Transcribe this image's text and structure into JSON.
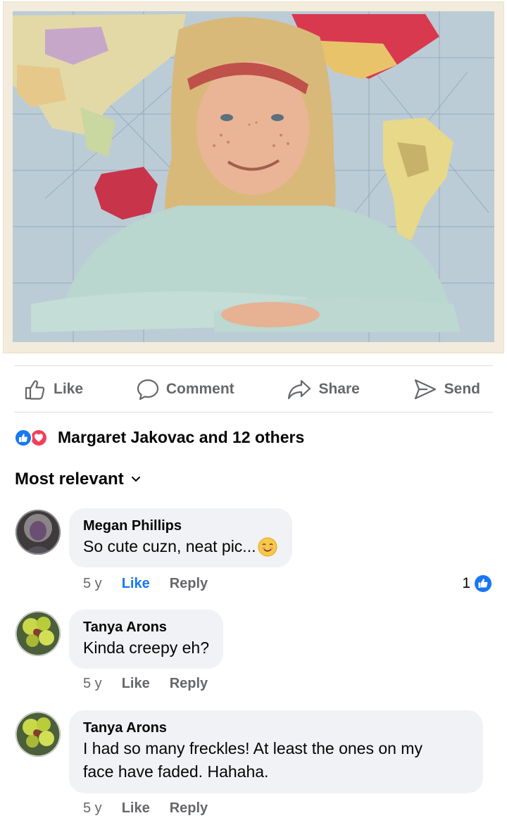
{
  "actions": {
    "like": "Like",
    "comment": "Comment",
    "share": "Share",
    "send": "Send"
  },
  "reactions": {
    "summary": "Margaret Jakovac and 12 others",
    "icons": [
      "like-icon",
      "love-icon"
    ]
  },
  "sort": {
    "label": "Most relevant"
  },
  "comments": [
    {
      "author": "Megan Phillips",
      "text": "So cute cuzn, neat pic...",
      "emoji": "smiling-face-emoji",
      "time": "5 y",
      "like": "Like",
      "reply": "Reply",
      "liked": true,
      "reaction_count": "1"
    },
    {
      "author": "Tanya Arons",
      "text": "Kinda creepy eh?",
      "time": "5 y",
      "like": "Like",
      "reply": "Reply"
    },
    {
      "author": "Tanya Arons",
      "text_line1": "I had so many freckles!  At least the ones on my",
      "text_line2": "face have faded.  Hahaha.",
      "time": "5 y",
      "like": "Like",
      "reply": "Reply"
    }
  ],
  "colors": {
    "accent": "#1877f2",
    "love": "#f33e58",
    "muted": "#65676b",
    "bubble": "#f0f2f5"
  }
}
